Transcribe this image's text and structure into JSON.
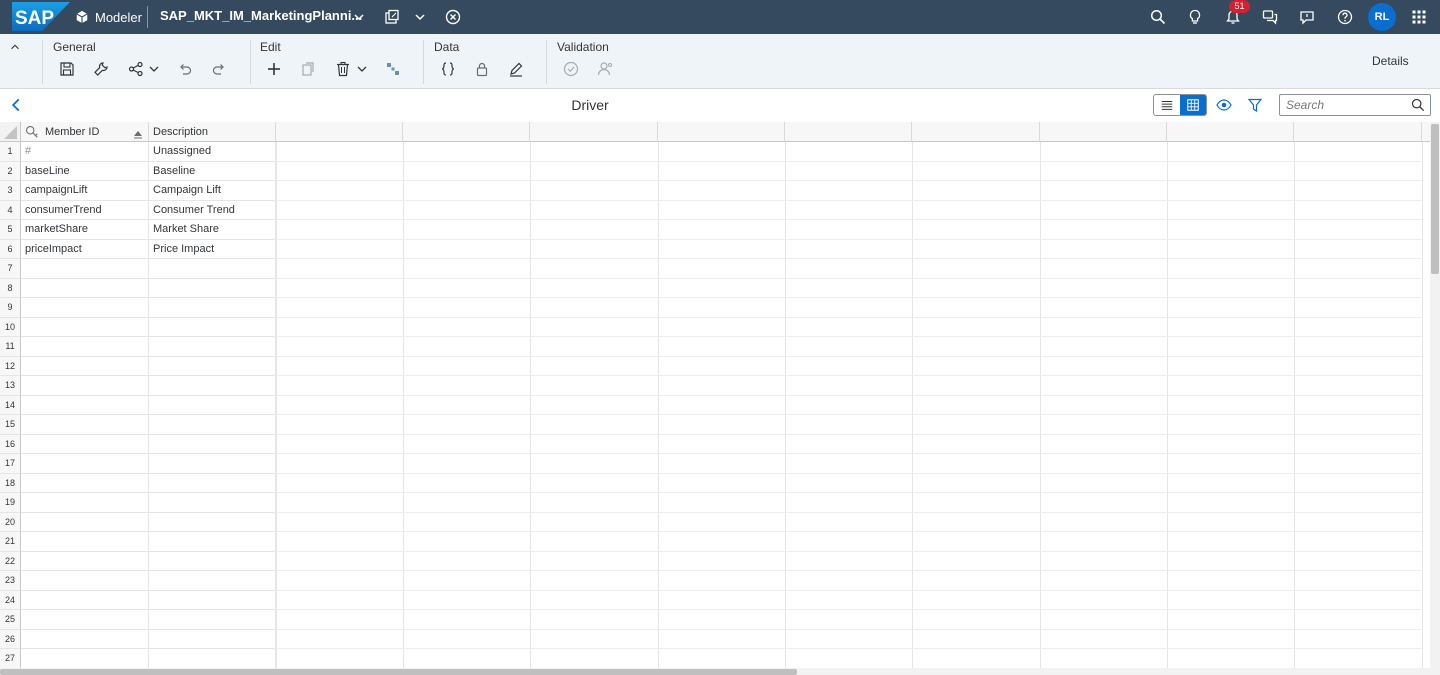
{
  "shell": {
    "logo_text": "SAP",
    "app_name": "Modeler",
    "file_title": "SAP_MKT_IM_MarketingPlanni...",
    "notification_count": "51",
    "user_initials": "RL"
  },
  "toolbar": {
    "groups": [
      {
        "label": "General"
      },
      {
        "label": "Edit"
      },
      {
        "label": "Data"
      },
      {
        "label": "Validation"
      }
    ],
    "details_label": "Details"
  },
  "page": {
    "title": "Driver",
    "search_placeholder": "Search"
  },
  "grid": {
    "columns": [
      "Member ID",
      "Description"
    ],
    "rows": [
      {
        "num": "1",
        "member_id": "#",
        "description": "Unassigned"
      },
      {
        "num": "2",
        "member_id": "baseLine",
        "description": "Baseline"
      },
      {
        "num": "3",
        "member_id": "campaignLift",
        "description": "Campaign Lift"
      },
      {
        "num": "4",
        "member_id": "consumerTrend",
        "description": "Consumer Trend"
      },
      {
        "num": "5",
        "member_id": "marketShare",
        "description": "Market Share"
      },
      {
        "num": "6",
        "member_id": "priceImpact",
        "description": "Price Impact"
      }
    ],
    "row_numbers": [
      "1",
      "2",
      "3",
      "4",
      "5",
      "6",
      "7",
      "8",
      "9",
      "10",
      "11",
      "12",
      "13",
      "14",
      "15",
      "16",
      "17",
      "18",
      "19",
      "20",
      "21",
      "22",
      "23",
      "24",
      "25",
      "26",
      "27"
    ]
  },
  "colors": {
    "shell_bg": "#354a5f",
    "toolbar_bg": "#eff4f9",
    "accent": "#0a6ed1",
    "badge": "#d32030"
  }
}
